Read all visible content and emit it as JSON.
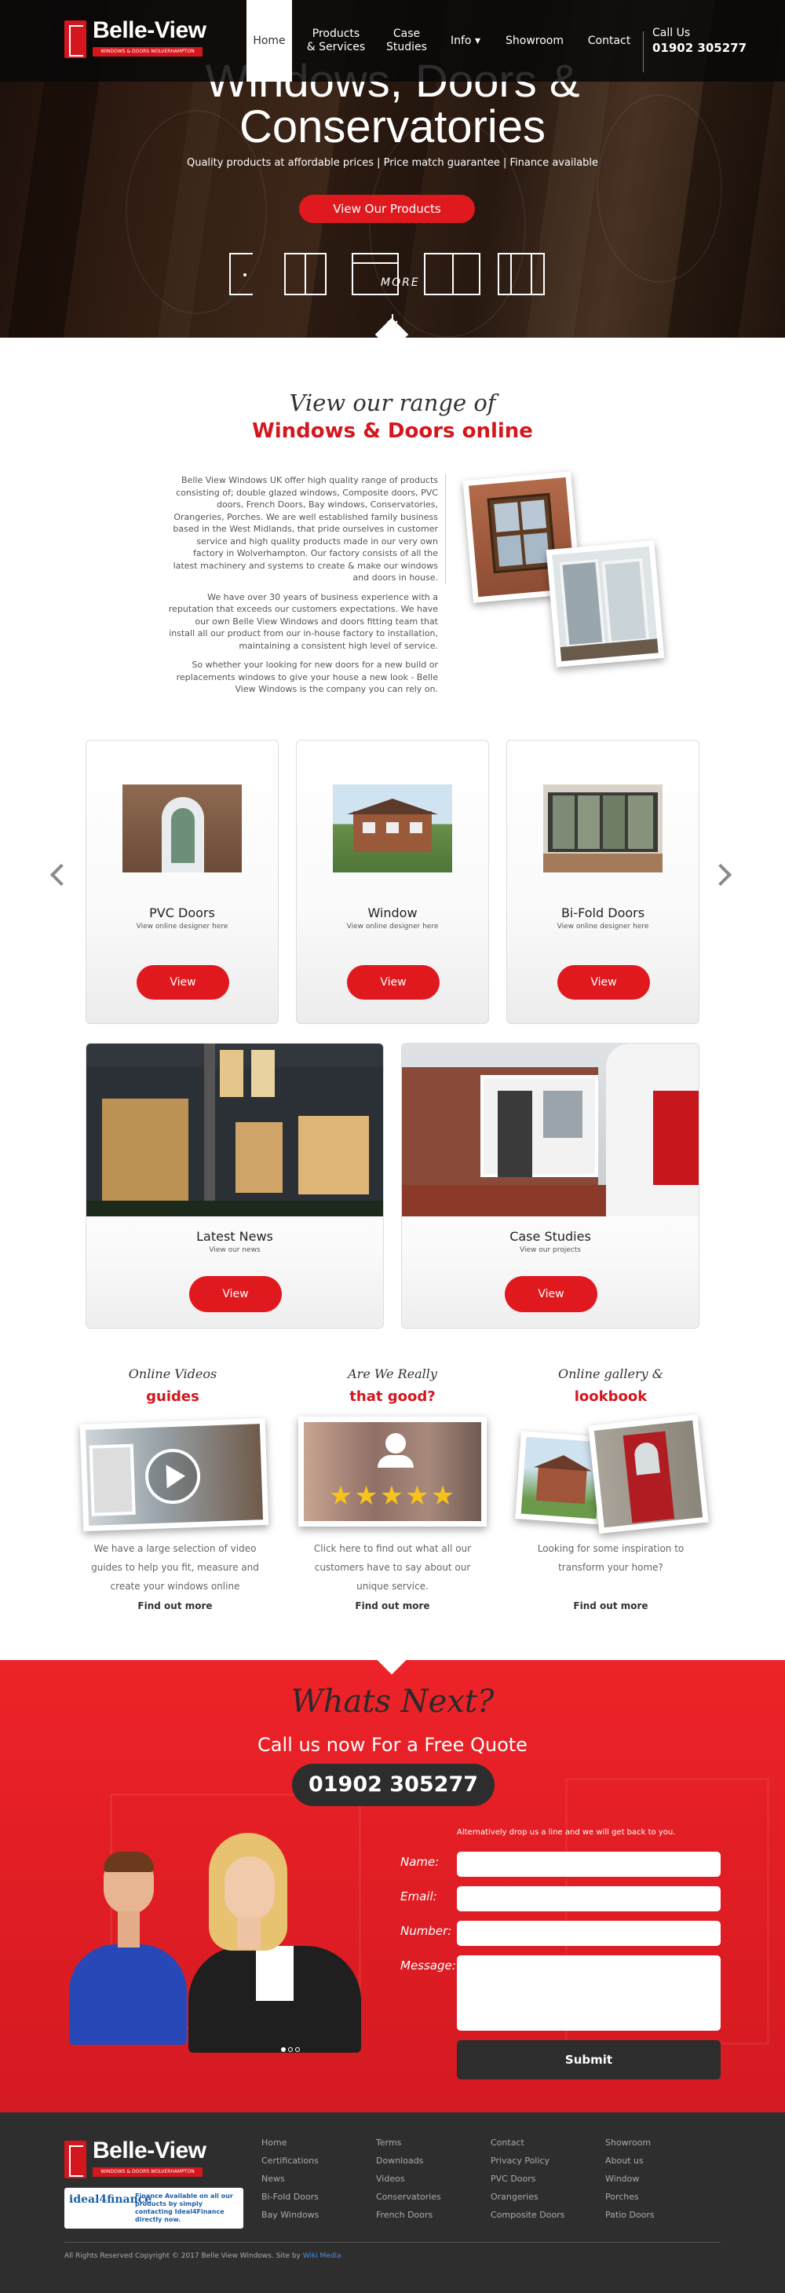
{
  "brand": {
    "name": "Belle-View",
    "tagline": "WINDOWS & DOORS WOLVERHAMPTON"
  },
  "nav": {
    "items": [
      {
        "label": "Home",
        "active": true
      },
      {
        "label": "Products\n& Services"
      },
      {
        "label": "Case\nStudies"
      },
      {
        "label": "Info ▾"
      },
      {
        "label": "Showroom"
      },
      {
        "label": "Contact"
      }
    ],
    "call_label": "Call Us",
    "call_number": "01902 305277"
  },
  "hero": {
    "title_line1": "Windows, Doors &",
    "title_line2": "Conservatories",
    "subtitle": "Quality products at affordable prices | Price match guarantee | Finance available",
    "cta": "View Our Products",
    "more_label": "MORE"
  },
  "range": {
    "pre_title": "View our range of",
    "title": "Windows & Doors online",
    "paragraphs": [
      "Belle View Windows UK offer high quality range of products consisting of; double glazed windows, Composite doors, PVC doors, French Doors, Bay windows, Conservatories, Orangeries, Porches. We are well established family business based in the West Midlands, that pride ourselves in customer service and high quality products made in our very own factory in Wolverhampton. Our factory consists of all the latest machinery and systems to create & make our windows and doors in house.",
      "We have over 30 years of business experience with a reputation that exceeds our customers expectations. We have our own Belle View Windows and doors fitting team that install all our product from our in-house factory to installation, maintaining a consistent high level of service.",
      "So whether your looking for new doors for a new build or replacements windows to give your house a new look - Belle View Windows is the company you can rely on."
    ]
  },
  "products": [
    {
      "title": "PVC Doors",
      "subtitle": "View online designer here",
      "button": "View"
    },
    {
      "title": "Window",
      "subtitle": "View online designer here",
      "button": "View"
    },
    {
      "title": "Bi-Fold Doors",
      "subtitle": "View online designer here",
      "button": "View"
    }
  ],
  "features": [
    {
      "title": "Latest News",
      "subtitle": "View our news",
      "button": "View"
    },
    {
      "title": "Case Studies",
      "subtitle": "View our projects",
      "button": "View"
    }
  ],
  "guides": [
    {
      "pre": "Online Videos",
      "title": "guides",
      "text": "We have a large selection of video guides to help you fit, measure and create your windows online",
      "link": "Find out more"
    },
    {
      "pre": "Are We Really",
      "title": "that good?",
      "text": "Click here to find out what all our customers have to say about our unique service.",
      "link": "Find out more"
    },
    {
      "pre": "Online gallery &",
      "title": "lookbook",
      "text": "Looking for some inspiration to transform your home?",
      "link": "Find out more"
    }
  ],
  "whats_next": {
    "title": "Whats Next?",
    "subtitle": "Call us now For a Free Quote",
    "phone": "01902 305277",
    "form_note": "Alternatively drop us a line and we will get back to you.",
    "labels": {
      "name": "Name:",
      "email": "Email:",
      "number": "Number:",
      "message": "Message:"
    },
    "submit": "Submit"
  },
  "footer": {
    "finance_text": "Finance Available on all our products by simply contacting Ideal4Finance directly now.",
    "finance_logo": "ideal4finance",
    "columns": [
      [
        "Home",
        "Certifications",
        "News",
        "Bi-Fold Doors",
        "Bay Windows"
      ],
      [
        "Terms",
        "Downloads",
        "Videos",
        "Conservatories",
        "French Doors"
      ],
      [
        "Contact",
        "Privacy Policy",
        "PVC Doors",
        "Orangeries",
        "Composite Doors"
      ],
      [
        "Showroom",
        "About us",
        "Window",
        "Porches",
        "Patio Doors"
      ]
    ],
    "copyright": "All Rights Reserved Copyright © 2017 Belle View Windows. Site by",
    "credit": "Wiki Media"
  },
  "colors": {
    "accent_red": "#e0191f",
    "dark": "#2d2d2d",
    "footer_bg": "#2e2e2e"
  },
  "icons": [
    "door-icon",
    "window-icon",
    "bifold-icon",
    "french-window-icon",
    "sliding-door-icon",
    "chevron-left-icon",
    "chevron-right-icon",
    "play-icon",
    "people-icon",
    "star-icon"
  ]
}
